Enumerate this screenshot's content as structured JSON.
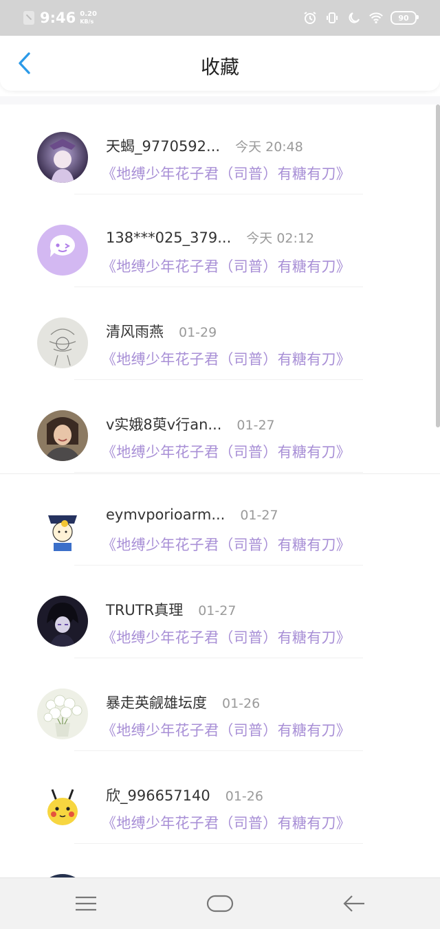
{
  "status_bar": {
    "time": "9:46",
    "speed_value": "0.20",
    "speed_unit": "KB/s",
    "battery": "90"
  },
  "header": {
    "title": "收藏",
    "back_icon": "chevron-left-icon"
  },
  "favorites": [
    {
      "name": "天蝎_9770592...",
      "time": "今天 20:48",
      "title": "《地缚少年花子君（司普）有糖有刀》",
      "avatar": "anime-character"
    },
    {
      "name": "138***025_379...",
      "time": "今天 02:12",
      "title": "《地缚少年花子君（司普）有糖有刀》",
      "avatar": "default-chat-bubble"
    },
    {
      "name": "清风雨燕",
      "time": "01-29",
      "title": "《地缚少年花子君（司普）有糖有刀》",
      "avatar": "pencil-sketch"
    },
    {
      "name": "v实娥8萸v行an...",
      "time": "01-27",
      "title": "《地缚少年花子君（司普）有糖有刀》",
      "avatar": "photo-person"
    },
    {
      "name": "eymvporioarm...",
      "time": "01-27",
      "title": "《地缚少年花子君（司普）有糖有刀》",
      "avatar": "cartoon-boy"
    },
    {
      "name": "TRUTR真理",
      "time": "01-27",
      "title": "《地缚少年花子君（司普）有糖有刀》",
      "avatar": "dark-anime"
    },
    {
      "name": "暴走英觎雄坛度",
      "time": "01-26",
      "title": "《地缚少年花子君（司普）有糖有刀》",
      "avatar": "flowers"
    },
    {
      "name": "欣_996657140",
      "time": "01-26",
      "title": "《地缚少年花子君（司普）有糖有刀》",
      "avatar": "pikachu"
    }
  ],
  "nav": {
    "menu_icon": "menu-icon",
    "home_icon": "home-icon",
    "back_icon": "back-arrow-icon"
  },
  "colors": {
    "accent": "#2b9ae8",
    "link": "#a88fd6",
    "status_bar_bg": "#d3d3d3"
  }
}
